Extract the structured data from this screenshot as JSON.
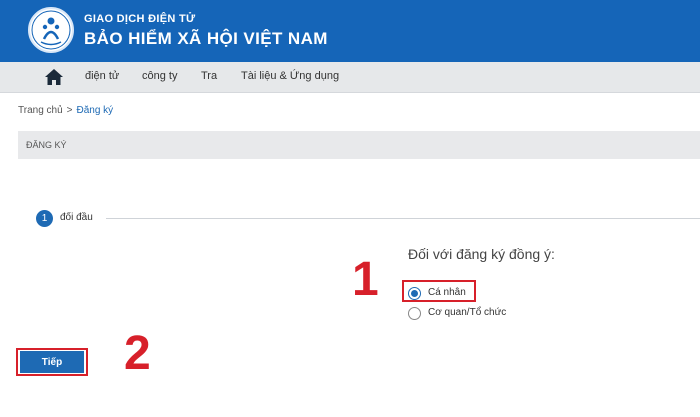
{
  "header": {
    "line1": "GIAO DỊCH ĐIỆN TỬ",
    "line2": "BẢO HIỂM XÃ HỘI VIỆT NAM",
    "logo_icon": "family-emblem-logo"
  },
  "nav": {
    "home_icon": "home-icon",
    "items": [
      {
        "label": "điện tử"
      },
      {
        "label": "công ty"
      },
      {
        "label": "Tra"
      },
      {
        "label": "Tài liệu & Ứng dụng"
      }
    ]
  },
  "breadcrumb": {
    "home": "Trang chủ",
    "separator": ">",
    "current": "Đăng ký"
  },
  "section": {
    "title": "ĐĂNG KÝ"
  },
  "step": {
    "number": "1",
    "label": "đối đầu"
  },
  "form": {
    "question": "Đối với đăng ký đồng ý:",
    "options": [
      {
        "label": "Cá nhân",
        "checked": true
      },
      {
        "label": "Cơ quan/Tổ chức",
        "checked": false
      }
    ]
  },
  "annotations": {
    "marker1": "1",
    "marker2": "2"
  },
  "actions": {
    "next_label": "Tiếp"
  },
  "colors": {
    "brand": "#1565b8",
    "accent": "#1e6ab4",
    "annotation": "#d7202a"
  }
}
